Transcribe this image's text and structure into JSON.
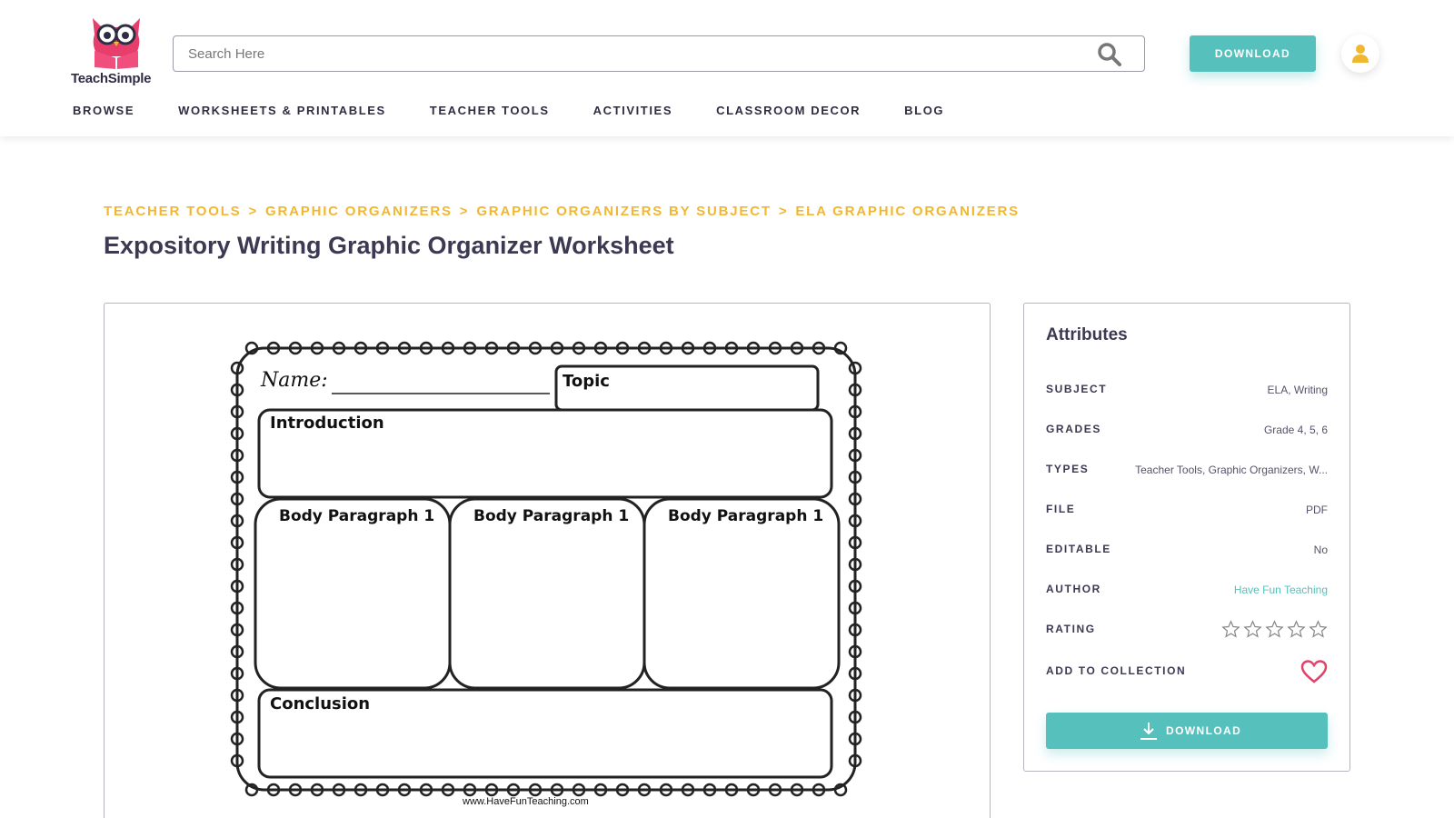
{
  "header": {
    "logo_text": "TeachSimple",
    "search_placeholder": "Search Here",
    "download_label": "DOWNLOAD"
  },
  "nav": {
    "items": [
      "BROWSE",
      "WORKSHEETS & PRINTABLES",
      "TEACHER TOOLS",
      "ACTIVITIES",
      "CLASSROOM DECOR",
      "BLOG"
    ]
  },
  "breadcrumb": [
    "TEACHER TOOLS",
    "GRAPHIC ORGANIZERS",
    "GRAPHIC ORGANIZERS BY SUBJECT",
    "ELA GRAPHIC ORGANIZERS"
  ],
  "breadcrumb_separator": ">",
  "title": "Expository Writing Graphic Organizer Worksheet",
  "worksheet": {
    "name_label": "Name:",
    "topic_label": "Topic",
    "introduction_label": "Introduction",
    "body_labels": [
      "Body Paragraph 1",
      "Body Paragraph 1",
      "Body Paragraph 1"
    ],
    "conclusion_label": "Conclusion",
    "footer": "www.HaveFunTeaching.com"
  },
  "attributes": {
    "title": "Attributes",
    "rows": [
      {
        "label": "SUBJECT",
        "value": "ELA, Writing"
      },
      {
        "label": "GRADES",
        "value": "Grade 4, 5, 6"
      },
      {
        "label": "TYPES",
        "value": "Teacher Tools, Graphic Organizers, W..."
      },
      {
        "label": "FILE",
        "value": "PDF"
      },
      {
        "label": "EDITABLE",
        "value": "No"
      },
      {
        "label": "AUTHOR",
        "value": "Have Fun Teaching"
      }
    ],
    "rating_label": "RATING",
    "rating_value": 0,
    "rating_max": 5,
    "collection_label": "ADD TO COLLECTION",
    "download_label": "DOWNLOAD"
  },
  "colors": {
    "accent": "#56c0bd",
    "breadcrumb": "#f2b731",
    "text": "#2f2d44",
    "heart": "#e0446a"
  },
  "icons": [
    "owl-logo-icon",
    "search-icon",
    "user-icon",
    "star-icon",
    "heart-icon",
    "download-icon"
  ]
}
